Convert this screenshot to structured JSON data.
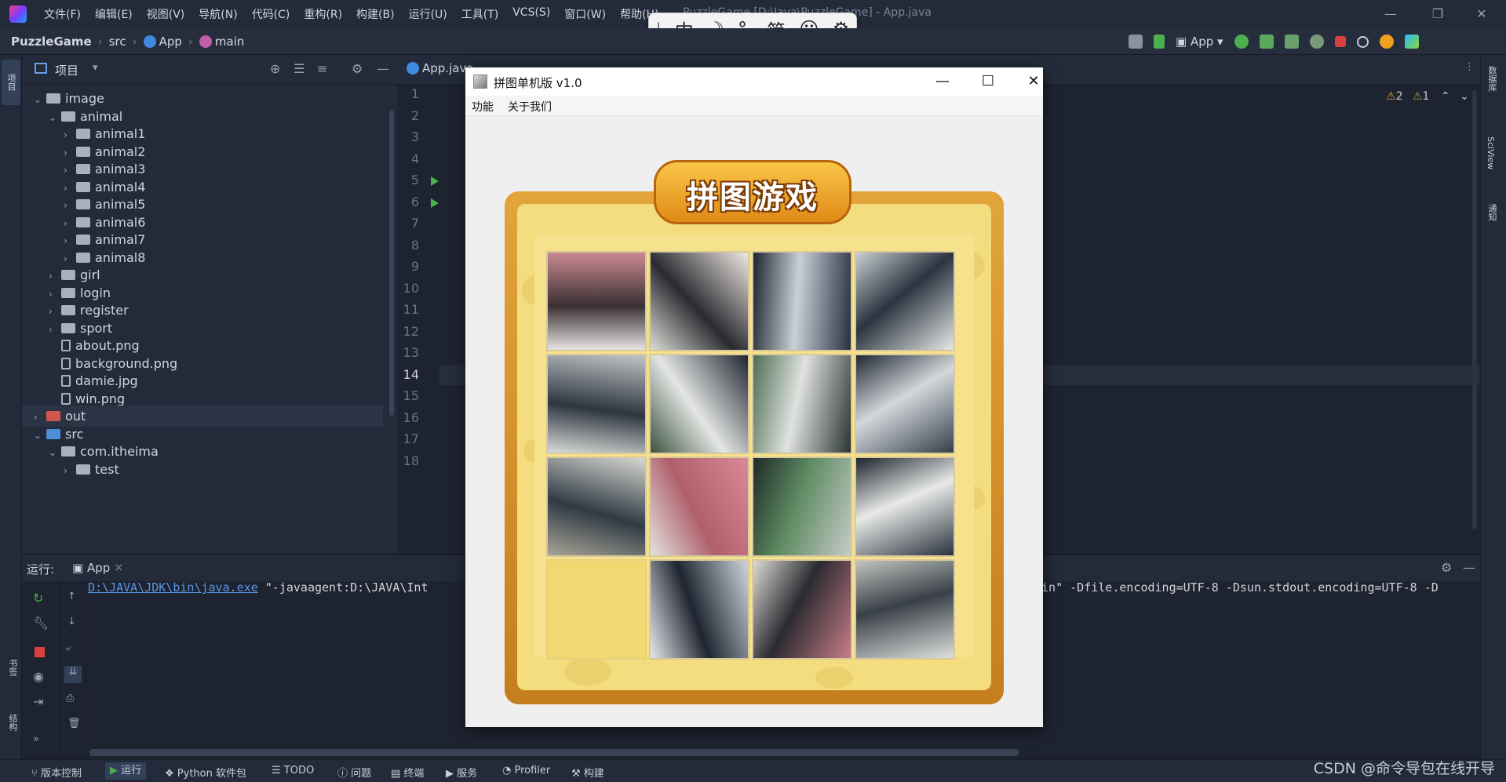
{
  "titlebar": {
    "menus": [
      "文件(F)",
      "编辑(E)",
      "视图(V)",
      "导航(N)",
      "代码(C)",
      "重构(R)",
      "构建(B)",
      "运行(U)",
      "工具(T)",
      "VCS(S)",
      "窗口(W)",
      "帮助(H)"
    ],
    "window_title": "PuzzleGame [D:\\Java\\PuzzleGame] - App.java"
  },
  "breadcrumb": {
    "project": "PuzzleGame",
    "folder": "src",
    "class": "App",
    "method": "main"
  },
  "run_config": "App",
  "project_panel": {
    "title": "项目",
    "tree": [
      {
        "label": "image",
        "kind": "folder",
        "depth": 1,
        "expanded": true
      },
      {
        "label": "animal",
        "kind": "folder",
        "depth": 2,
        "expanded": true
      },
      {
        "label": "animal1",
        "kind": "folder",
        "depth": 3,
        "expanded": false
      },
      {
        "label": "animal2",
        "kind": "folder",
        "depth": 3,
        "expanded": false
      },
      {
        "label": "animal3",
        "kind": "folder",
        "depth": 3,
        "expanded": false
      },
      {
        "label": "animal4",
        "kind": "folder",
        "depth": 3,
        "expanded": false
      },
      {
        "label": "animal5",
        "kind": "folder",
        "depth": 3,
        "expanded": false
      },
      {
        "label": "animal6",
        "kind": "folder",
        "depth": 3,
        "expanded": false
      },
      {
        "label": "animal7",
        "kind": "folder",
        "depth": 3,
        "expanded": false
      },
      {
        "label": "animal8",
        "kind": "folder",
        "depth": 3,
        "expanded": false
      },
      {
        "label": "girl",
        "kind": "folder",
        "depth": 2,
        "expanded": false
      },
      {
        "label": "login",
        "kind": "folder",
        "depth": 2,
        "expanded": false
      },
      {
        "label": "register",
        "kind": "folder",
        "depth": 2,
        "expanded": false
      },
      {
        "label": "sport",
        "kind": "folder",
        "depth": 2,
        "expanded": false
      },
      {
        "label": "about.png",
        "kind": "file",
        "depth": 2
      },
      {
        "label": "background.png",
        "kind": "file",
        "depth": 2
      },
      {
        "label": "damie.jpg",
        "kind": "file",
        "depth": 2
      },
      {
        "label": "win.png",
        "kind": "file",
        "depth": 2
      },
      {
        "label": "out",
        "kind": "folder-red",
        "depth": 1,
        "expanded": false
      },
      {
        "label": "src",
        "kind": "folder-blue",
        "depth": 1,
        "expanded": true
      },
      {
        "label": "com.itheima",
        "kind": "folder",
        "depth": 2,
        "expanded": true
      },
      {
        "label": "test",
        "kind": "folder",
        "depth": 3,
        "expanded": false
      }
    ]
  },
  "editor": {
    "tabs": [
      "App.java"
    ],
    "line_numbers": [
      "1",
      "2",
      "3",
      "4",
      "5",
      "6",
      "7",
      "8",
      "9",
      "10",
      "11",
      "12",
      "13",
      "14",
      "15",
      "16",
      "17",
      "18"
    ],
    "current_line": "14",
    "inspections": {
      "warnings": "2",
      "weak_warnings": "1"
    }
  },
  "run_panel": {
    "label": "运行:",
    "tab": "App",
    "cmd_link": "D:\\JAVA\\JDK\\bin\\java.exe",
    "cmd_rest": " \"-javaagent:D:\\JAVA\\Int",
    "cmd_tail": "bin\" -Dfile.encoding=UTF-8 -Dsun.stdout.encoding=UTF-8 -D"
  },
  "statusbar": {
    "items": [
      "版本控制",
      "运行",
      "Python 软件包",
      "TODO",
      "问题",
      "终端",
      "服务",
      "Profiler",
      "构建"
    ],
    "watermark": "CSDN @命令导包在线开导"
  },
  "right_strip": [
    "数据库",
    "SciView",
    "通知"
  ],
  "left_strip": [
    "项目",
    "书签",
    "结构"
  ],
  "ime_toolbar": [
    "中",
    "☽",
    "°,",
    "简",
    "☺",
    "⚙"
  ],
  "puzzle_window": {
    "title": "拼图单机版 v1.0",
    "menus": [
      "功能",
      "关于我们"
    ],
    "banner": "拼图游戏",
    "empty_tile_index": 12,
    "tiles": [
      {
        "a": "#e8e4e2",
        "b": "#3a3034",
        "c": "#c98a90"
      },
      {
        "a": "#dcdcd6",
        "b": "#2a2a30",
        "c": "#efe9e4"
      },
      {
        "a": "#1f2530",
        "b": "#c8d0d8",
        "c": "#2a3040"
      },
      {
        "a": "#c9d0d2",
        "b": "#2b3440",
        "c": "#e5e8e6"
      },
      {
        "a": "#d8dcd8",
        "b": "#2e3540",
        "c": "#c0c6c6"
      },
      {
        "a": "#3c5240",
        "b": "#e4e6e4",
        "c": "#1f2530"
      },
      {
        "a": "#4d6e54",
        "b": "#e0e2e0",
        "c": "#2a3430"
      },
      {
        "a": "#1e2632",
        "b": "#d4d8dc",
        "c": "#34404a"
      },
      {
        "a": "#a8a496",
        "b": "#2f3a44",
        "c": "#d8d8d2"
      },
      {
        "a": "#e2e2de",
        "b": "#b0606c",
        "c": "#d98a96"
      },
      {
        "a": "#1f2a28",
        "b": "#5e8c62",
        "c": "#c6cac8"
      },
      {
        "a": "#1c232c",
        "b": "#e8eae8",
        "c": "#2a323c"
      },
      {
        "a": "#f2d872",
        "b": "#f2d872",
        "c": "#f2d872"
      },
      {
        "a": "#e6eaee",
        "b": "#1f2530",
        "c": "#cfd6de"
      },
      {
        "a": "#dcdcd6",
        "b": "#2b2a30",
        "c": "#c77d88"
      },
      {
        "a": "#bfc4be",
        "b": "#3a4048",
        "c": "#dcdfdc"
      }
    ]
  },
  "colors": {
    "accent": "#5896e8",
    "frame_gold": "#e3a43b",
    "run_green": "#4caf50"
  }
}
